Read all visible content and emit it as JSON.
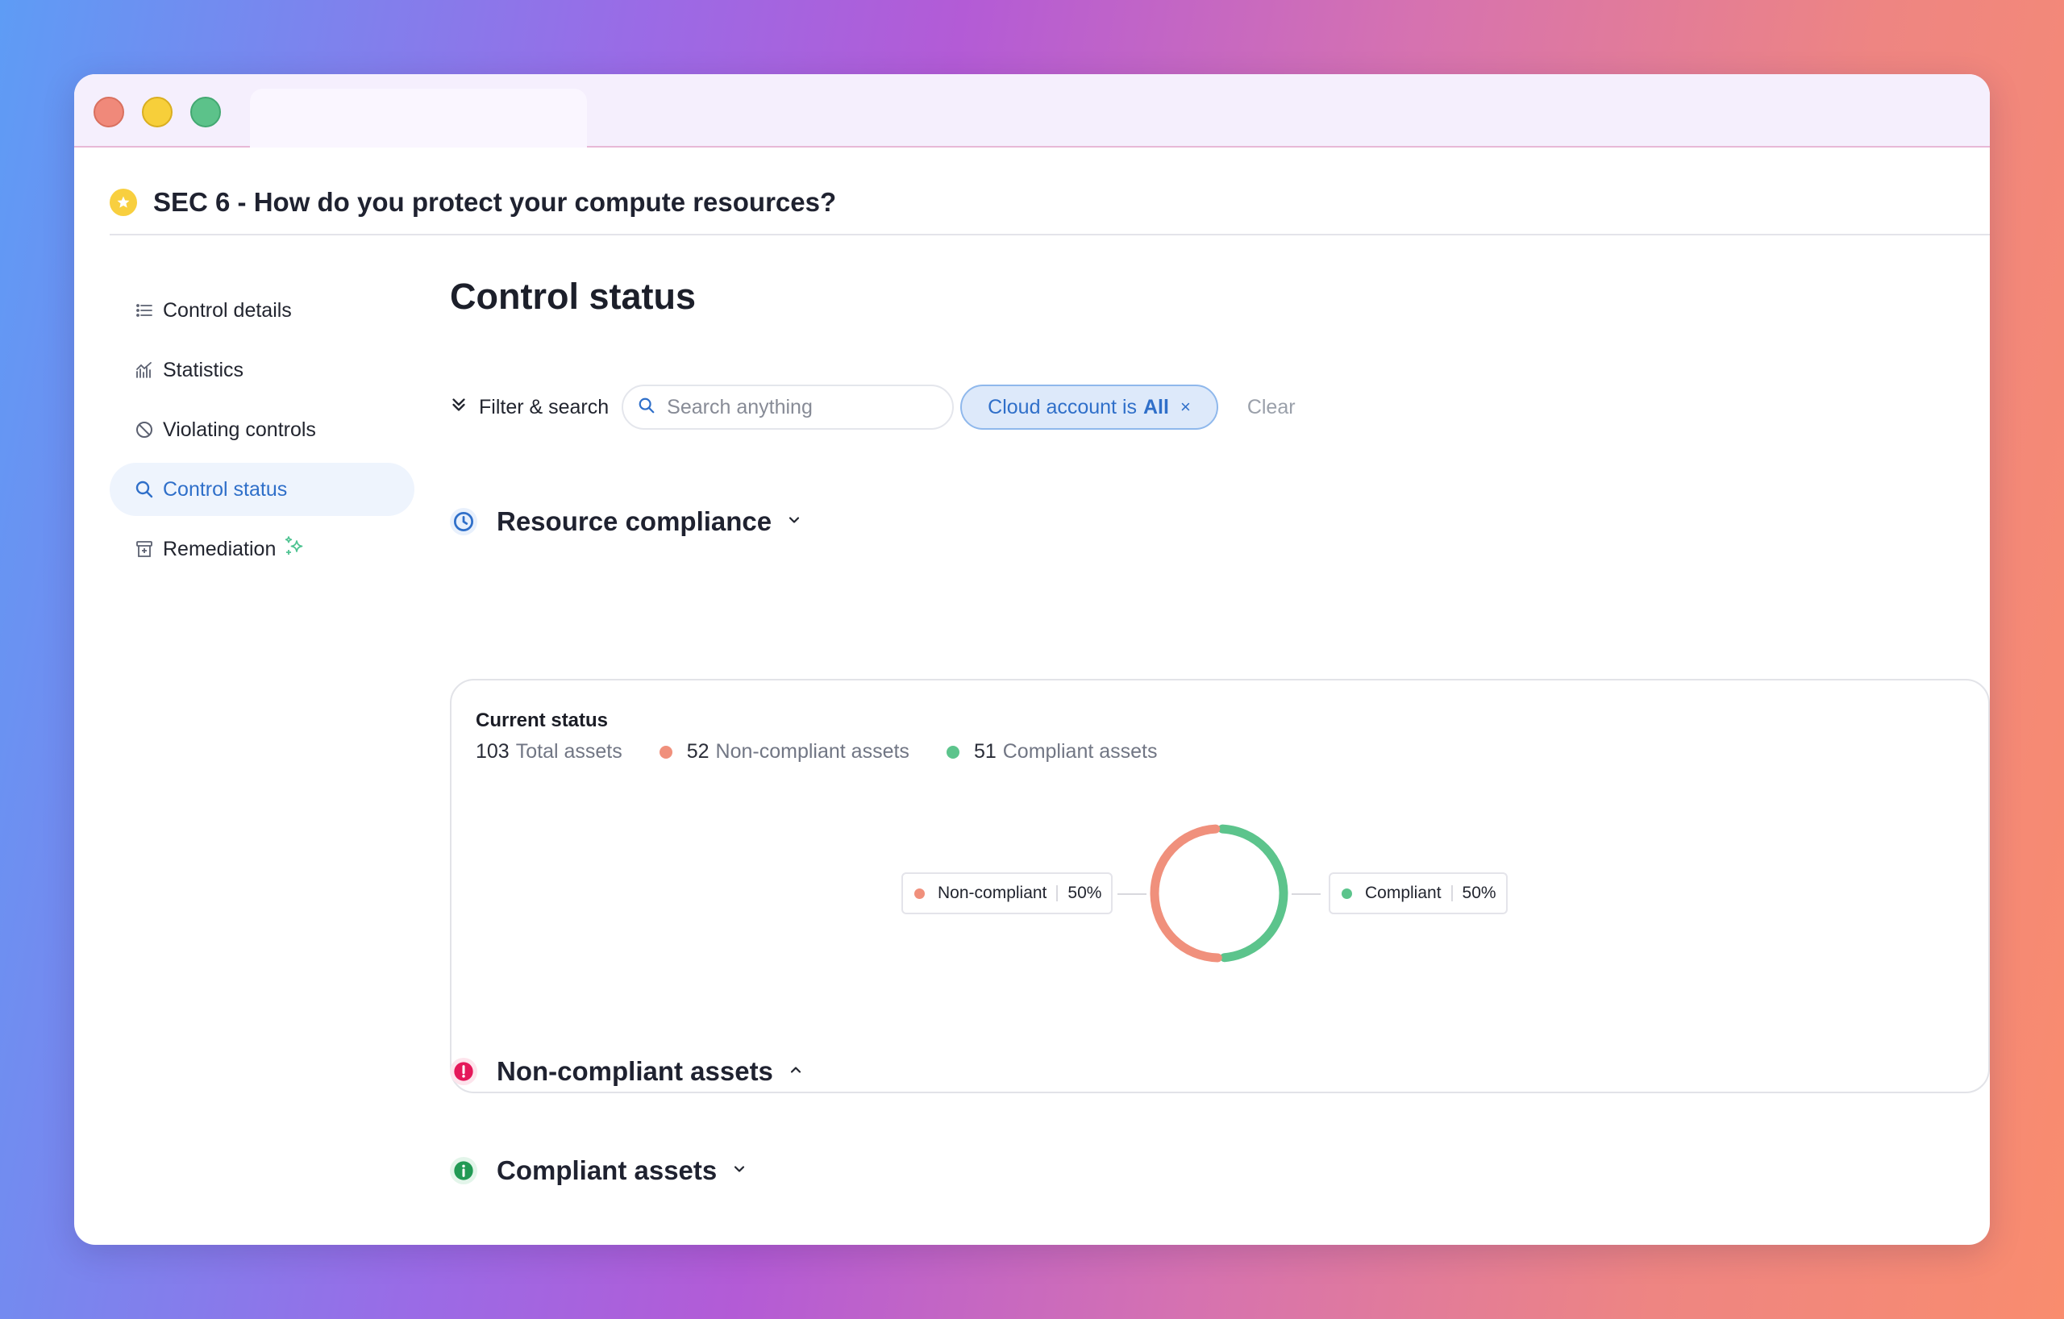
{
  "header": {
    "title": "SEC 6 - How do you protect your compute resources?"
  },
  "sidebar": {
    "items": [
      {
        "label": "Control details",
        "icon": "list-icon"
      },
      {
        "label": "Statistics",
        "icon": "chart-icon"
      },
      {
        "label": "Violating controls",
        "icon": "ban-icon"
      },
      {
        "label": "Control status",
        "icon": "search-icon",
        "active": true
      },
      {
        "label": "Remediation",
        "icon": "archive-icon"
      }
    ]
  },
  "main": {
    "title": "Control status",
    "filter": {
      "label": "Filter & search",
      "search_placeholder": "Search anything",
      "chip_prefix": "Cloud account is",
      "chip_value": "All",
      "chip_close": "×",
      "clear_label": "Clear"
    },
    "sections": {
      "resource_compliance": "Resource compliance",
      "non_compliant": "Non-compliant assets",
      "compliant": "Compliant assets"
    },
    "card": {
      "title": "Current status",
      "total_num": "103",
      "total_label": "Total assets",
      "noncompliant_num": "52",
      "noncompliant_label": "Non-compliant assets",
      "compliant_num": "51",
      "compliant_label": "Compliant assets"
    }
  },
  "chart_data": {
    "type": "pie",
    "categories": [
      "Non-compliant",
      "Compliant"
    ],
    "values": [
      52,
      51
    ],
    "percent_labels": [
      "50%",
      "50%"
    ],
    "colors": [
      "#f0907c",
      "#5cc48c"
    ]
  },
  "colors": {
    "accent": "#2f6fc9",
    "noncompliant": "#f0907c",
    "compliant": "#5cc48c",
    "warning_icon": "#e5185a"
  }
}
